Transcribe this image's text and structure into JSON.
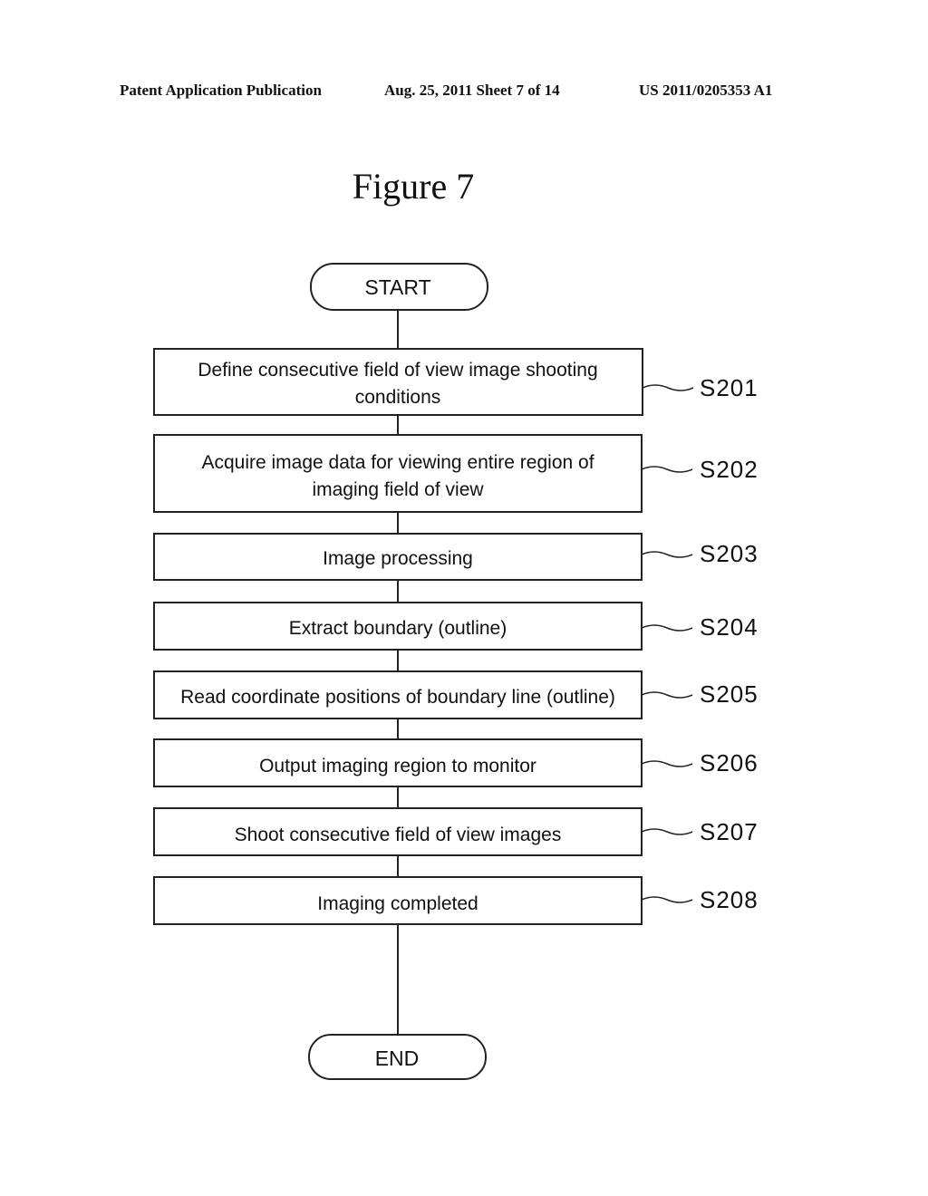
{
  "header": {
    "publication": "Patent Application Publication",
    "date_sheet": "Aug. 25, 2011  Sheet 7 of 14",
    "patent_number": "US 2011/0205353 A1"
  },
  "figure": {
    "title": "Figure 7"
  },
  "flowchart": {
    "start": "START",
    "end": "END",
    "steps": [
      {
        "id": "S201",
        "lines": [
          "Define consecutive field of view image shooting",
          "conditions"
        ]
      },
      {
        "id": "S202",
        "lines": [
          "Acquire image data for viewing entire region of",
          "imaging field of view"
        ]
      },
      {
        "id": "S203",
        "lines": [
          "Image processing"
        ]
      },
      {
        "id": "S204",
        "lines": [
          "Extract boundary (outline)"
        ]
      },
      {
        "id": "S205",
        "lines": [
          "Read coordinate positions of boundary line (outline)"
        ]
      },
      {
        "id": "S206",
        "lines": [
          "Output imaging region to monitor"
        ]
      },
      {
        "id": "S207",
        "lines": [
          "Shoot consecutive field of view images"
        ]
      },
      {
        "id": "S208",
        "lines": [
          "Imaging completed"
        ]
      }
    ]
  }
}
